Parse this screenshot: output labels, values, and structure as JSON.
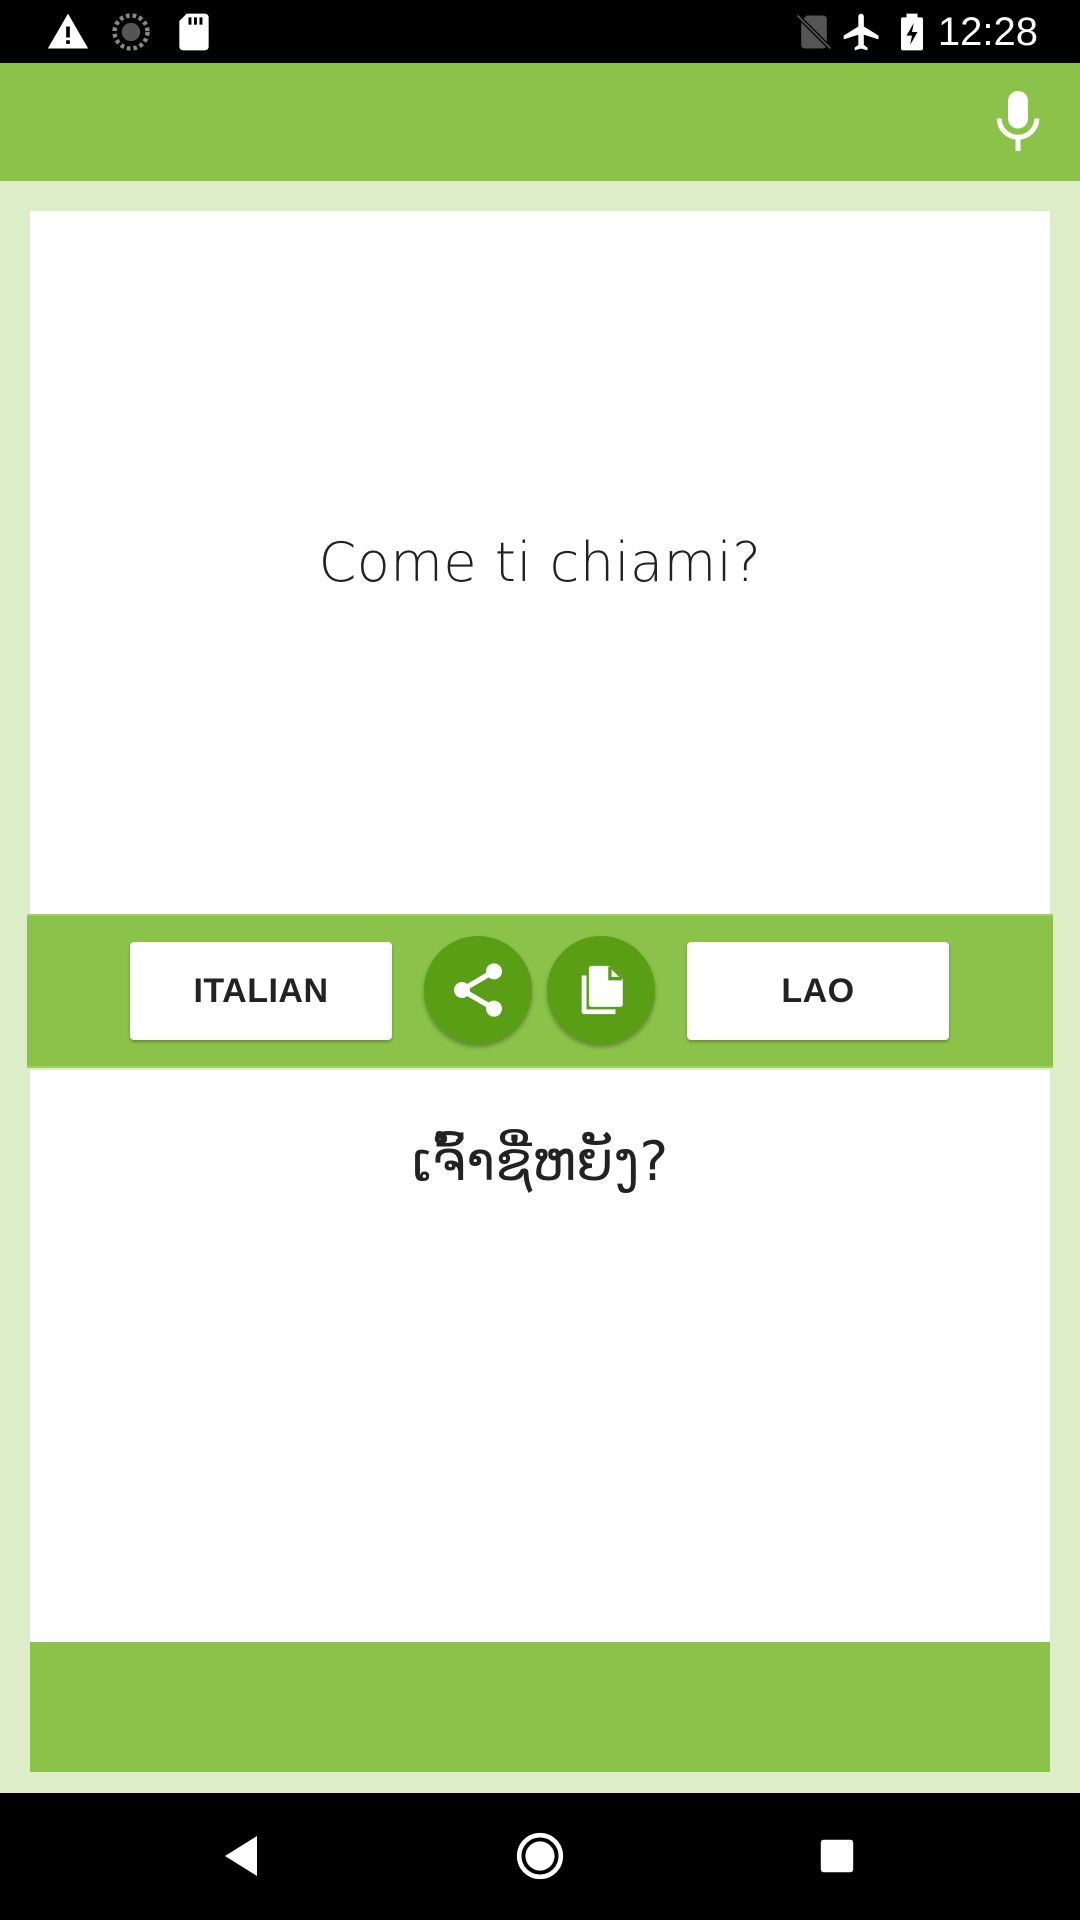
{
  "status_bar": {
    "time": "12:28",
    "icons": [
      "alert-icon",
      "sync-icon",
      "sd-card-icon",
      "no-sim-icon",
      "airplane-mode-icon",
      "battery-charging-icon"
    ]
  },
  "app_bar": {
    "mic_icon": "microphone-icon",
    "accent_color": "#8bc34a"
  },
  "translator": {
    "source_text": "Come ti chiami?",
    "target_text": "ເຈົ້າຊື່ຫຍັງ?",
    "source_language": "ITALIAN",
    "target_language": "LAO",
    "share_icon": "share-icon",
    "copy_icon": "copy-icon"
  },
  "colors": {
    "primary": "#8bc34a",
    "fab": "#5a9e15",
    "background": "#dcedc8"
  },
  "nav_bar": {
    "icons": [
      "back-icon",
      "home-icon",
      "recents-icon"
    ]
  }
}
